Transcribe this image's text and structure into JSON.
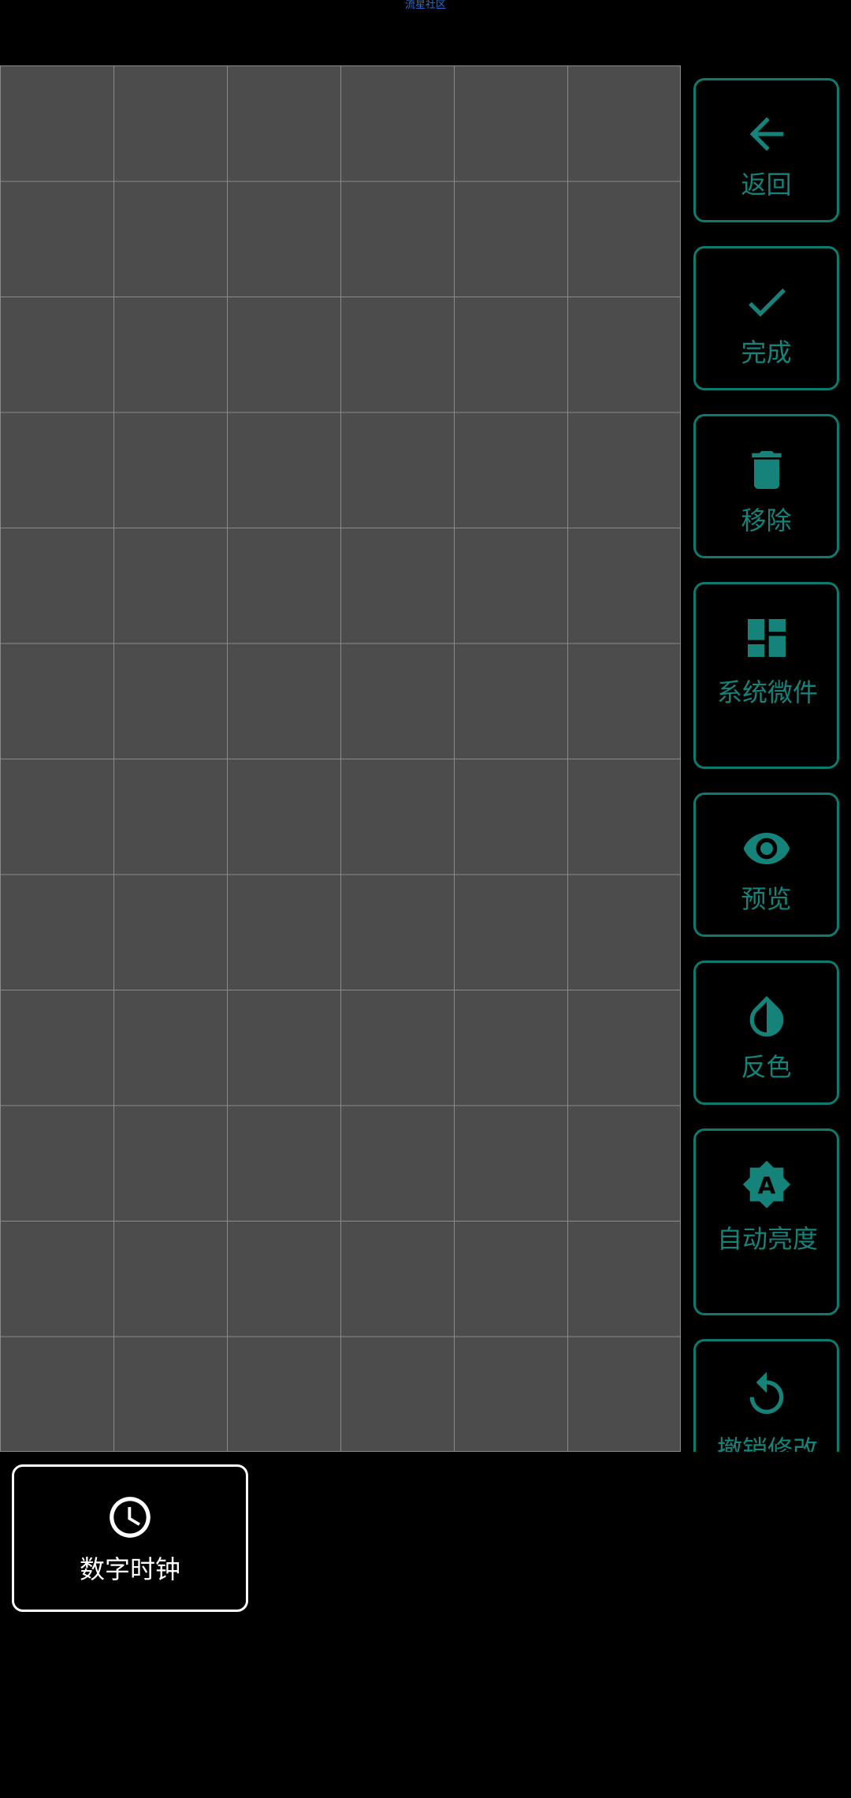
{
  "status_bar": {
    "watermark": "流星社区"
  },
  "side_actions": [
    {
      "label": "返回",
      "icon": "arrow-back-icon"
    },
    {
      "label": "完成",
      "icon": "check-icon"
    },
    {
      "label": "移除",
      "icon": "trash-icon"
    },
    {
      "label": "系统微件",
      "icon": "dashboard-icon"
    },
    {
      "label": "预览",
      "icon": "eye-icon"
    },
    {
      "label": "反色",
      "icon": "invert-colors-icon"
    },
    {
      "label": "自动亮度",
      "icon": "auto-brightness-icon"
    },
    {
      "label": "撤销修改",
      "icon": "undo-icon"
    }
  ],
  "widget_picker": {
    "items": [
      {
        "label": "数字时钟",
        "icon": "clock-icon"
      }
    ]
  },
  "colors": {
    "background": "#000000",
    "grid_cell": "#4c4c4c",
    "grid_line": "#8a8a8a",
    "accent": "#15837a",
    "accent_border": "#0d7a6e",
    "widget_text": "#ffffff"
  }
}
